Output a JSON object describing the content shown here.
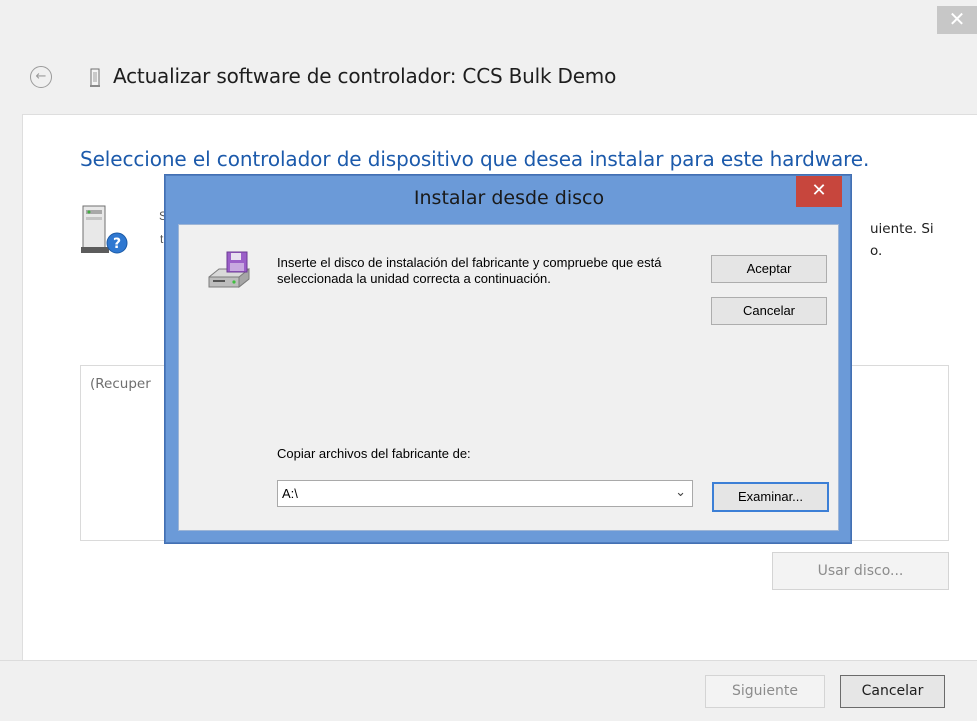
{
  "window": {
    "close_glyph": "✕",
    "back_glyph": "←",
    "title": "Actualizar software de controlador: CCS Bulk Demo"
  },
  "main": {
    "heading": "Seleccione el controlador de dispositivo que desea instalar para este hardware.",
    "partial_line1": "S",
    "partial_line2": "t",
    "right_text_line1": "uiente. Si",
    "right_text_line2": "o.",
    "list_item": "(Recuper",
    "use_disk_label": "Usar disco..."
  },
  "footer": {
    "next_label": "Siguiente",
    "cancel_label": "Cancelar"
  },
  "dialog": {
    "title": "Instalar desde disco",
    "close_glyph": "✕",
    "message": "Inserte el disco de instalación del fabricante y compruebe que está seleccionada la unidad correcta a continuación.",
    "ok_label": "Aceptar",
    "cancel_label": "Cancelar",
    "copy_label": "Copiar archivos del fabricante de:",
    "path_value": "A:\\",
    "browse_label": "Examinar..."
  },
  "colors": {
    "heading_blue": "#1c5aab",
    "dialog_frame": "#6b9ad8",
    "dialog_close_red": "#c7463d"
  }
}
